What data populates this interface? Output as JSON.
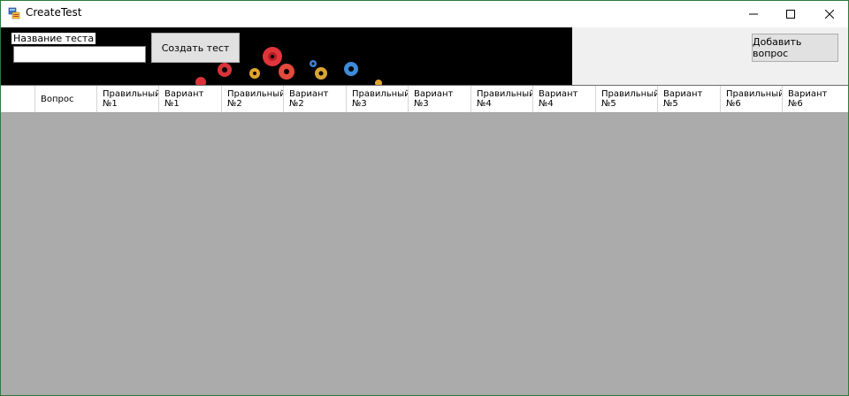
{
  "window": {
    "title": "CreateTest",
    "controls": [
      "minimize-icon",
      "maximize-icon",
      "close-icon"
    ]
  },
  "header": {
    "test_name_label": "Название теста",
    "test_name_value": "",
    "create_button": "Создать тест",
    "add_question_button": "Добавить вопрос"
  },
  "grid": {
    "columns": [
      {
        "line1": "Вопрос",
        "line2": ""
      },
      {
        "line1": "Правильный",
        "line2": "№1"
      },
      {
        "line1": "Вариант",
        "line2": "№1"
      },
      {
        "line1": "Правильный",
        "line2": "№2"
      },
      {
        "line1": "Вариант",
        "line2": "№2"
      },
      {
        "line1": "Правильный",
        "line2": "№3"
      },
      {
        "line1": "Вариант",
        "line2": "№3"
      },
      {
        "line1": "Правильный",
        "line2": "№4"
      },
      {
        "line1": "Вариант",
        "line2": "№4"
      },
      {
        "line1": "Правильный",
        "line2": "№5"
      },
      {
        "line1": "Вариант",
        "line2": "№5"
      },
      {
        "line1": "Правильный",
        "line2": "№6"
      },
      {
        "line1": "Вариант",
        "line2": "№6"
      }
    ],
    "rows": []
  },
  "colors": {
    "grid_background": "#ababab",
    "banner_background": "#000000",
    "button_face": "#e1e1e1",
    "window_border": "#2d7a3a"
  }
}
